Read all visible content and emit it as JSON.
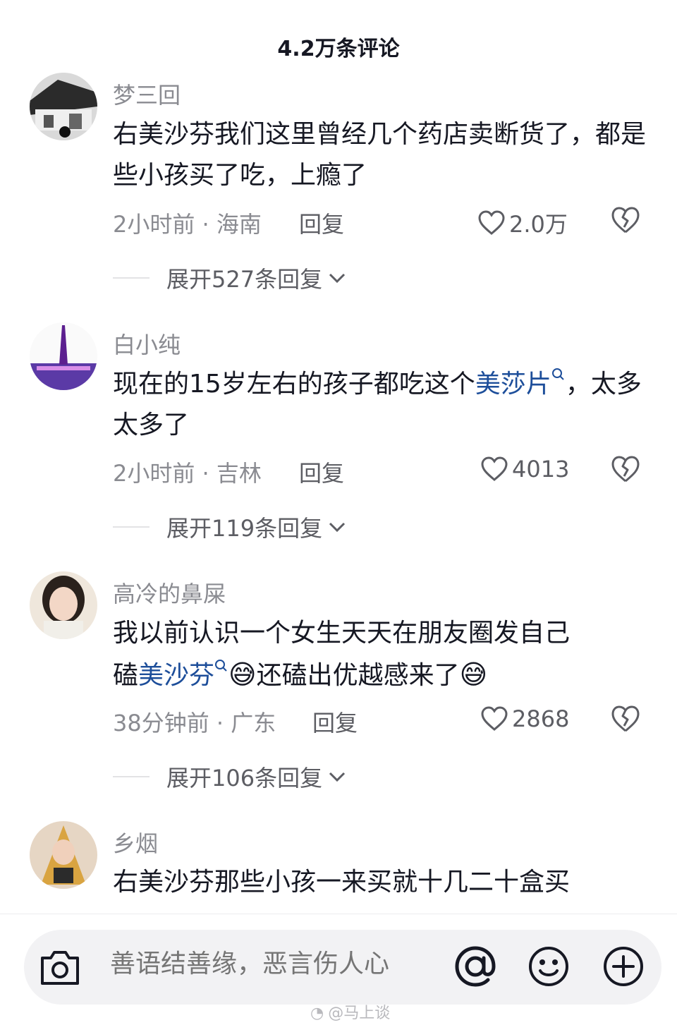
{
  "header": {
    "title": "4.2万条评论"
  },
  "comments": [
    {
      "username": "梦三回",
      "content_segments": [
        "右美沙芬我们这里曾经几个药店卖断货了，都是些小孩买了吃，上瘾了"
      ],
      "time_location": "2小时前 · 海南",
      "reply_label": "回复",
      "likes": "2.0万",
      "expand_label": "展开527条回复"
    },
    {
      "username": "白小纯",
      "content_before": "现在的15岁左右的孩子都吃这个",
      "keyword": "美莎片",
      "content_after": "，太多太多了",
      "time_location": "2小时前 · 吉林",
      "reply_label": "回复",
      "likes": "4013",
      "expand_label": "展开119条回复"
    },
    {
      "username": "高冷的鼻屎",
      "content_line1": "我以前认识一个女生天天在朋友圈发自己",
      "content_prefix": "磕",
      "keyword": "美沙芬",
      "emoji": "😅",
      "content_middle": "还磕出优越感来了",
      "time_location": "38分钟前 · 广东",
      "reply_label": "回复",
      "likes": "2868",
      "expand_label": "展开106条回复"
    },
    {
      "username": "乡烟",
      "content": "右美沙芬那些小孩一来买就十几二十盒买"
    }
  ],
  "input_bar": {
    "placeholder": "善语结善缘，恶言伤人心"
  },
  "watermark": {
    "text": "@马上谈"
  },
  "icons": [
    "camera-icon",
    "at-icon",
    "emoji-icon",
    "plus-icon",
    "heart-icon",
    "broken-heart-icon",
    "chevron-down-icon",
    "search-icon"
  ],
  "colors": {
    "keyword": "#1d4e9a",
    "meta": "#8a8b91",
    "text": "#161823"
  }
}
